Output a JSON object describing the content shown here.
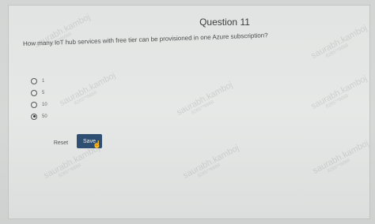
{
  "quiz": {
    "title": "Question 11",
    "question": "How many IoT hub services with free tier can be provisioned in one Azure subscription?",
    "options": [
      {
        "label": "1",
        "selected": false
      },
      {
        "label": "5",
        "selected": false
      },
      {
        "label": "10",
        "selected": false
      },
      {
        "label": "50",
        "selected": true
      }
    ],
    "reset_label": "Reset",
    "save_label": "Save"
  },
  "watermark": {
    "name": "saurabh.kamboj",
    "number": "8265**8668"
  },
  "colors": {
    "save_button": "#2f4f72",
    "panel": "#e4e6e5"
  }
}
